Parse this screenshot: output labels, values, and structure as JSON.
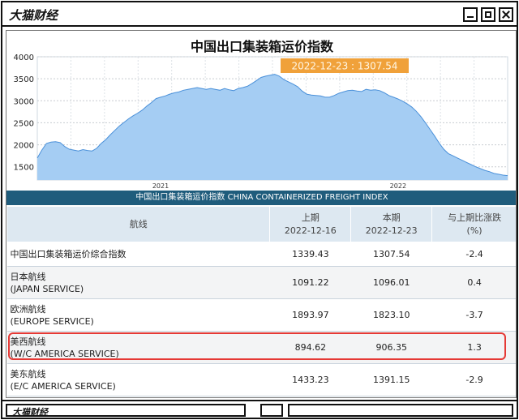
{
  "window": {
    "brand": "大猫财经",
    "footer_brand": "大猫财经"
  },
  "chart_data": {
    "type": "area",
    "title": "中国出口集装箱运价指数",
    "ylim": [
      1200,
      4000
    ],
    "yticks": [
      "4000",
      "3500",
      "3000",
      "2500",
      "2000",
      "1500"
    ],
    "ytick_values": [
      4000,
      3500,
      3000,
      2500,
      2000,
      1500
    ],
    "xticks": [
      {
        "label": "2021",
        "week": 27
      },
      {
        "label": "2022",
        "week": 79
      }
    ],
    "x_weeks_total": 104,
    "values": [
      1700,
      1880,
      2030,
      2060,
      2070,
      2050,
      1960,
      1900,
      1880,
      1860,
      1890,
      1870,
      1860,
      1920,
      2030,
      2120,
      2230,
      2330,
      2430,
      2510,
      2590,
      2660,
      2720,
      2790,
      2880,
      2960,
      3050,
      3080,
      3110,
      3150,
      3180,
      3200,
      3240,
      3260,
      3280,
      3300,
      3280,
      3260,
      3280,
      3260,
      3240,
      3280,
      3250,
      3230,
      3280,
      3300,
      3330,
      3390,
      3460,
      3530,
      3560,
      3580,
      3600,
      3560,
      3480,
      3430,
      3380,
      3320,
      3220,
      3150,
      3130,
      3120,
      3110,
      3080,
      3080,
      3120,
      3170,
      3200,
      3230,
      3240,
      3220,
      3210,
      3260,
      3240,
      3250,
      3230,
      3180,
      3120,
      3080,
      3040,
      2990,
      2930,
      2860,
      2760,
      2640,
      2500,
      2350,
      2200,
      2040,
      1900,
      1800,
      1750,
      1700,
      1650,
      1600,
      1550,
      1500,
      1460,
      1420,
      1390,
      1350,
      1330,
      1310,
      1300
    ],
    "tooltip": {
      "date": "2022-12-23",
      "separator": ":",
      "value": "1307.54"
    },
    "fill_color": "#a5cdf3",
    "line_color": "#4a90d9",
    "tooltip_color": "#f0a13a"
  },
  "table": {
    "banner": "中国出口集装箱运价指数 CHINA CONTAINERIZED FREIGHT INDEX",
    "headers": {
      "route": "航线",
      "prev_label": "上期",
      "prev_date": "2022-12-16",
      "curr_label": "本期",
      "curr_date": "2022-12-23",
      "change_label": "与上期比涨跌",
      "change_unit": "(%)"
    },
    "rows": [
      {
        "name": "中国出口集装箱运价综合指数",
        "name_en": "",
        "prev": "1339.43",
        "curr": "1307.54",
        "change": "-2.4"
      },
      {
        "name": "日本航线",
        "name_en": "(JAPAN SERVICE)",
        "prev": "1091.22",
        "curr": "1096.01",
        "change": "0.4"
      },
      {
        "name": "欧洲航线",
        "name_en": "(EUROPE SERVICE)",
        "prev": "1893.97",
        "curr": "1823.10",
        "change": "-3.7"
      },
      {
        "name": "美西航线",
        "name_en": "(W/C AMERICA SERVICE)",
        "prev": "894.62",
        "curr": "906.35",
        "change": "1.3"
      },
      {
        "name": "美东航线",
        "name_en": "(E/C AMERICA SERVICE)",
        "prev": "1433.23",
        "curr": "1391.15",
        "change": "-2.9"
      }
    ]
  }
}
